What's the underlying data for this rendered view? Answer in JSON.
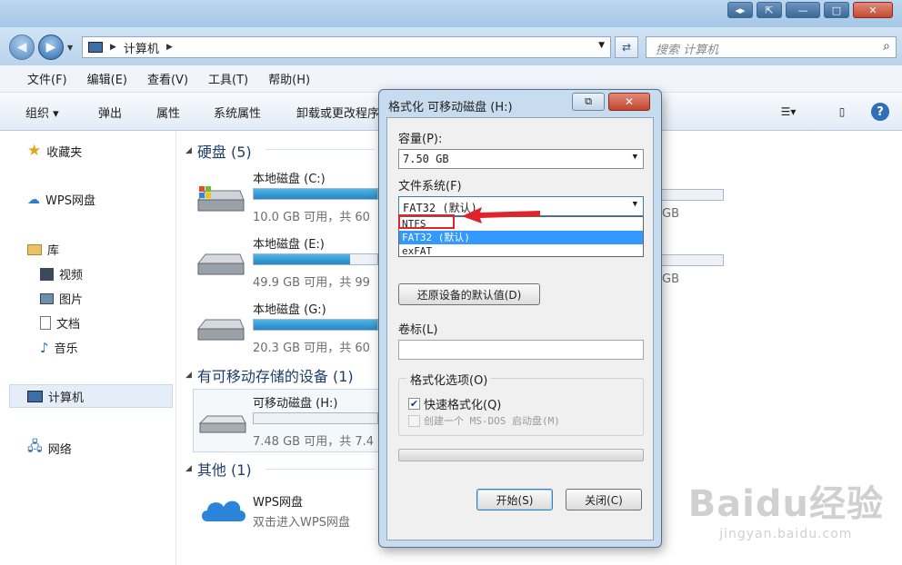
{
  "window": {
    "caption_buttons": [
      "◂▸",
      "⇱",
      "—",
      "□",
      "✕"
    ]
  },
  "address": {
    "path": "计算机",
    "search_placeholder": "搜索 计算机"
  },
  "menu": {
    "items": [
      "文件(F)",
      "编辑(E)",
      "查看(V)",
      "工具(T)",
      "帮助(H)"
    ]
  },
  "commands": {
    "organize": "组织 ▾",
    "eject": "弹出",
    "properties": "属性",
    "system_properties": "系统属性",
    "uninstall": "卸载或更改程序"
  },
  "sidebar": {
    "favorites": "收藏夹",
    "wps_cloud": "WPS网盘",
    "libraries": "库",
    "videos": "视频",
    "pictures": "图片",
    "documents": "文档",
    "music": "音乐",
    "computer": "计算机",
    "network": "网络"
  },
  "main": {
    "hard_disks_header": "硬盘 (5)",
    "removable_header": "有可移动存储的设备 (1)",
    "other_header": "其他 (1)",
    "drives": [
      {
        "name": "本地磁盘 (C:)",
        "info": "10.0 GB 可用，共 60",
        "used_fraction": 0.84,
        "right_info": "GB"
      },
      {
        "name": "本地磁盘 (E:)",
        "info": "49.9 GB 可用，共 99",
        "used_fraction": 0.5,
        "right_info": "GB"
      },
      {
        "name": "本地磁盘 (G:)",
        "info": "20.3 GB 可用，共 60",
        "used_fraction": 0.66,
        "right_info": ""
      }
    ],
    "removable": {
      "name": "可移动磁盘 (H:)",
      "info": "7.48 GB 可用，共 7.4",
      "used_fraction": 0.0
    },
    "wps": {
      "name": "WPS网盘",
      "desc": "双击进入WPS网盘"
    }
  },
  "dialog": {
    "title": "格式化 可移动磁盘 (H:)",
    "close_label": "✕",
    "capacity_label": "容量(P):",
    "capacity_value": "7.50 GB",
    "filesystem_label": "文件系统(F)",
    "filesystem_value": "FAT32 (默认)",
    "filesystem_options": [
      "NTFS",
      "FAT32 (默认)",
      "exFAT"
    ],
    "selected_option_index": 1,
    "restore_button": "还原设备的默认值(D)",
    "volume_label": "卷标(L)",
    "volume_value": "",
    "format_options_label": "格式化选项(O)",
    "quick_format": "快速格式化(Q)",
    "quick_format_checked": true,
    "msdos": "创建一个 MS-DOS 启动盘(M)",
    "msdos_checked": false,
    "start_button": "开始(S)",
    "close_button": "关闭(C)"
  },
  "watermark": {
    "main": "Baidu经验",
    "sub": "jingyan.baidu.com"
  },
  "colors": {
    "accent": "#2686c6",
    "selection": "#3399ff",
    "highlight": "#e0242b"
  }
}
